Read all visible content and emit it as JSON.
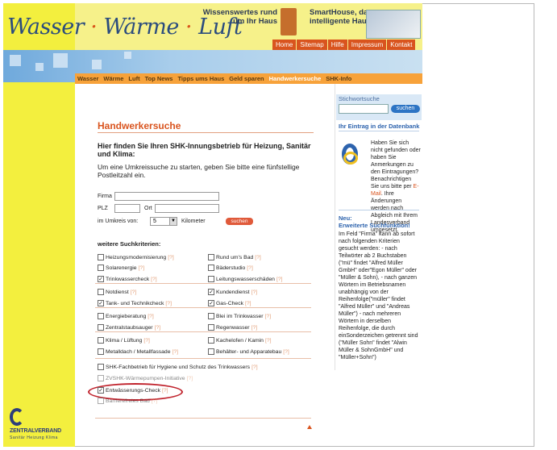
{
  "header": {
    "logo_part1": "Wasser",
    "logo_sep1": "·",
    "logo_part2": "Wärme",
    "logo_sep2": "·",
    "logo_part3": "Luft",
    "promo1": "Wissenswertes rund um Ihr Haus",
    "promo2": "SmartHouse, das intelligente Haus"
  },
  "topnav": [
    "Home",
    "Sitemap",
    "Hilfe",
    "Impressum",
    "Kontakt"
  ],
  "mainnav": {
    "items": [
      "Wasser",
      "Wärme",
      "Luft",
      "Top News",
      "Tipps ums Haus",
      "Geld sparen",
      "Handwerkersuche",
      "SHK-Info"
    ],
    "active": "Handwerkersuche"
  },
  "sidebar": {
    "search_label": "Stichwortsuche",
    "search_button": "suchen",
    "entry_heading": "Ihr Eintrag in der Datenbank",
    "entry_text1": "Haben Sie sich nicht gefunden oder haben Sie Anmerkungen zu den Eintragungen? Benachrichtigen Sie uns bitte per",
    "entry_link": "E-Mail",
    "entry_text2": ". Ihre Änderungen werden nach Abgleich mit Ihrem Landesverband umgesetzt.",
    "new_heading": "Neu:",
    "new_heading2": "Erweiterte Suchfunktion!",
    "new_text": "Im Feld \"Firma\" kann ab sofort nach folgenden Kriterien gesucht werden: - nach Teilwörter ab 2 Buchstaben (\"mü\" findet \"Alfred Müller GmbH\" oder\"Egon Müller\" oder \"Müller & Sohn), - nach ganzen Wörtern im Betriebsnamen unabhängig von der Reihenfolge(\"müller\" findet \"Alfred Müller\" und \"Andreas Müller\") - nach mehreren Wörtern in derselben Reihenfolge, die durch einSonderzeichen getrennt sind (\"Müller Sohn\" findet \"Alwin Müller & SohnGmbH\" und \"Müller+Sohn\")"
  },
  "main": {
    "title": "Handwerkersuche",
    "intro_heading": "Hier finden Sie Ihren SHK-Innungsbetrieb für Heizung, Sanitär und Klima:",
    "intro_text": "Um eine Umkreissuche zu starten, geben Sie bitte eine fünfstellige Postleitzahl ein.",
    "form": {
      "firma_label": "Firma",
      "plz_label": "PLZ",
      "ort_label": "Ort",
      "umkreis_label": "im Umkreis von:",
      "umkreis_value": "5",
      "km_label": "Kilometer",
      "search_button": "suchen"
    },
    "criteria_heading": "weitere Suchkriterien:",
    "q": "[?]",
    "criteria": [
      {
        "label": "Heizungsmodernisierung",
        "checked": false
      },
      {
        "label": "Rund um's Bad",
        "checked": false
      },
      {
        "label": "Solarenergie",
        "checked": false
      },
      {
        "label": "Bäderstudio",
        "checked": false
      },
      {
        "label": "Trinkwassercheck",
        "checked": true
      },
      {
        "label": "Leitungswasserschäden",
        "checked": false
      },
      {
        "label": "Notdienst",
        "checked": false
      },
      {
        "label": "Kundendienst",
        "checked": true
      },
      {
        "label": "Tank- und Technikcheck",
        "checked": true
      },
      {
        "label": "Gas-Check",
        "checked": true
      },
      {
        "label": "Energieberatung",
        "checked": false
      },
      {
        "label": "Blei im Trinkwasser",
        "checked": false
      },
      {
        "label": "Zentralstaubsauger",
        "checked": false
      },
      {
        "label": "Regenwasser",
        "checked": false
      },
      {
        "label": "Klima / Lüftung",
        "checked": false
      },
      {
        "label": "Kachelofen / Kamin",
        "checked": false
      },
      {
        "label": "Metalldach / Metallfassade",
        "checked": false
      },
      {
        "label": "Behälter- und Apparatebau",
        "checked": false
      },
      {
        "label": "SHK-Fachbetrieb für Hygiene und Schutz des Trinkwassers",
        "checked": false
      },
      {
        "label": "ZVSHK-Wärmepumpen-Initiative",
        "checked": false
      },
      {
        "label": "Entwässerungs-Check",
        "checked": true
      },
      {
        "label": "Barrierefreies Bad",
        "checked": false
      }
    ]
  },
  "footer": {
    "logo_text": "ZENTRALVERBAND",
    "logo_sub": "Sanitär Heizung Klima"
  },
  "colors": {
    "accent": "#d9541e",
    "yellow": "#f3ef3e",
    "link_blue": "#2d63ad",
    "highlight_circle": "#c0222c"
  }
}
